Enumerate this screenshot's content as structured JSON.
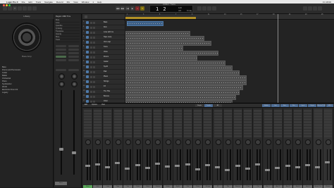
{
  "menubar": {
    "apple": "",
    "app": "Logic Pro X",
    "items": [
      "File",
      "Edit",
      "Track",
      "Navigate",
      "Record",
      "Mix",
      "View",
      "Window",
      "1",
      "Help"
    ],
    "clock": "Fri 18:00"
  },
  "window_title": "Untitled - Tracks",
  "transport": {
    "position": "1 2",
    "tempo": "120",
    "signature": "4/4",
    "key": "Cmaj"
  },
  "library": {
    "title": "Library",
    "patch_name": "Bass Amp",
    "items": [
      "Bass",
      "Drums and Percussion",
      "Guitar",
      "Mallet",
      "Orchestral",
      "Piano",
      "Synthesizer",
      "World",
      "Electronic Drum Kit",
      "Legacy"
    ]
  },
  "inspector": {
    "region_label": "Region: MIDI Thru",
    "rows": [
      "Mute",
      "Loop",
      "Quantize",
      "Q-Swing",
      "Transpose",
      "Velocity",
      "More",
      "Track"
    ],
    "track_name": "Bass"
  },
  "tracks": [
    {
      "num": "1",
      "name": "Bass",
      "color": "#4e79a8"
    },
    {
      "num": "2",
      "name": "Kick",
      "color": "#4e79a8"
    },
    {
      "num": "3",
      "name": "Lose with me",
      "color": "#4e79a8"
    },
    {
      "num": "4",
      "name": "Tape Loop",
      "color": "#4e79a8"
    },
    {
      "num": "5",
      "name": "Vox Loop",
      "color": "#4e79a8"
    },
    {
      "num": "6",
      "name": "Toms",
      "color": "#4e79a8"
    },
    {
      "num": "7",
      "name": "Voice",
      "color": "#4e79a8"
    },
    {
      "num": "8",
      "name": "Drums",
      "color": "#4e79a8"
    },
    {
      "num": "9",
      "name": "Guitar",
      "color": "#4e79a8"
    },
    {
      "num": "10",
      "name": "Synth",
      "color": "#4e79a8"
    },
    {
      "num": "11",
      "name": "Pad",
      "color": "#4e79a8"
    },
    {
      "num": "12",
      "name": "Piano",
      "color": "#4e79a8"
    },
    {
      "num": "13",
      "name": "Strings",
      "color": "#4e79a8"
    },
    {
      "num": "14",
      "name": "FX",
      "color": "#4e79a8"
    },
    {
      "num": "15",
      "name": "The Title",
      "color": "#4e79a8"
    },
    {
      "num": "16",
      "name": "Bounce",
      "color": "#4e79a8"
    },
    {
      "num": "17",
      "name": "Choir",
      "color": "#4e79a8"
    }
  ],
  "ruler": [
    "1",
    "3",
    "5",
    "7",
    "9",
    "11",
    "13",
    "15",
    "17",
    "19",
    "21",
    "23",
    "25"
  ],
  "mixer": {
    "tabs": [
      "Edit",
      "Options",
      "View"
    ],
    "buttons": [
      "Single",
      "Tracks",
      "All"
    ],
    "right_buttons": [
      "Audio",
      "Inst",
      "Aux",
      "Bus",
      "Input",
      "Output",
      "Master/VCA",
      "MIDI"
    ],
    "strips": [
      "Bass",
      "Kick",
      "Lose",
      "Tape",
      "Vox",
      "Toms",
      "Voice",
      "Drums",
      "Guitar",
      "Synth",
      "Pad",
      "Piano",
      "Strings",
      "FX",
      "Title",
      "Bounce",
      "Choir",
      "Out",
      "Aux 1",
      "Aux 2",
      "Aux 3",
      "Aux 4",
      "Aux 5",
      "Stereo Out",
      "Master"
    ]
  }
}
